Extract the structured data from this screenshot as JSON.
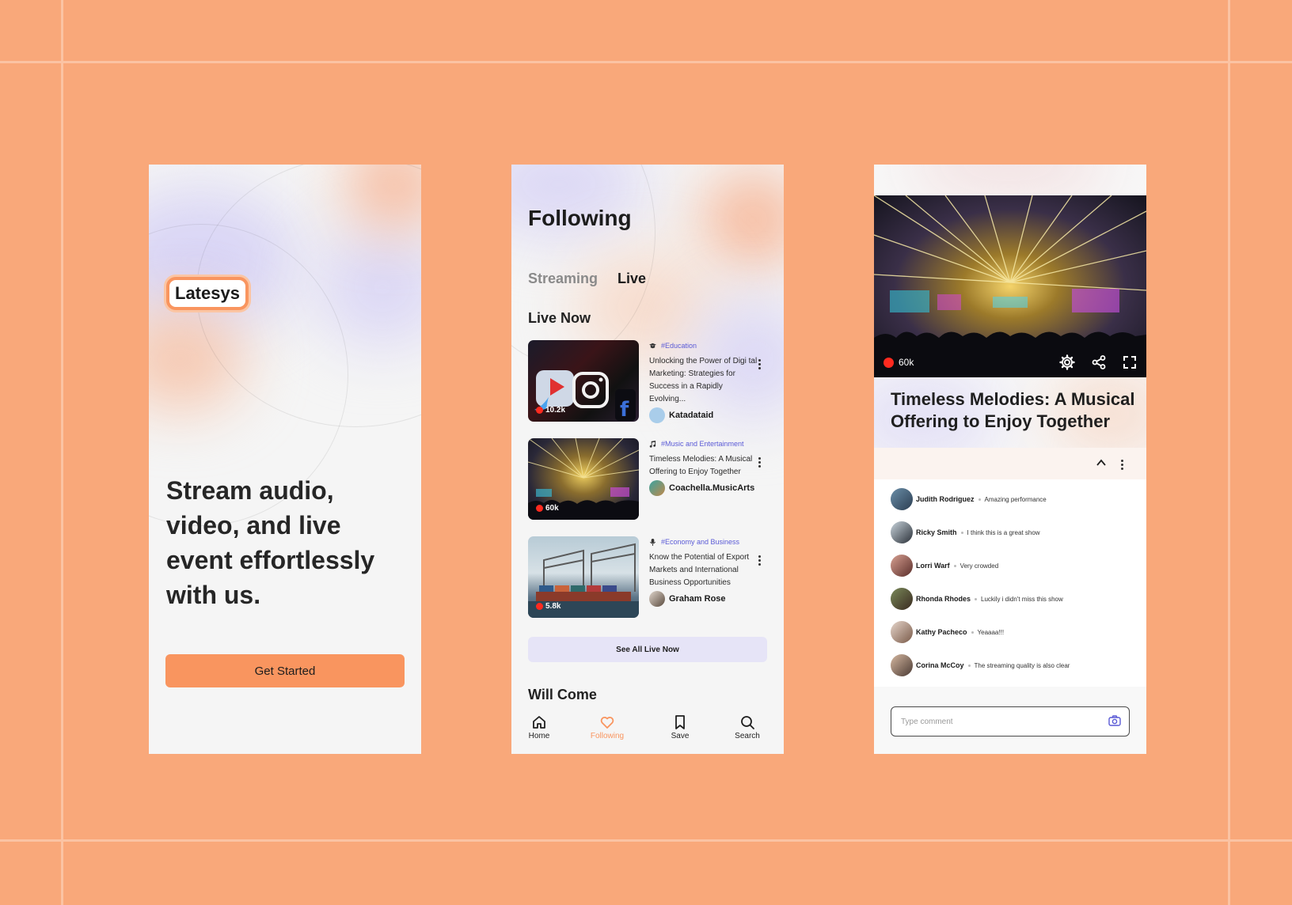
{
  "screen1": {
    "logo": "Latesys",
    "hero": "Stream audio, video, and live event effortlessly with us.",
    "cta": "Get Started"
  },
  "screen2": {
    "title": "Following",
    "tabs": [
      {
        "label": "Streaming",
        "active": false
      },
      {
        "label": "Live",
        "active": true
      }
    ],
    "live_now_title": "Live Now",
    "cards": [
      {
        "tag": "#Education",
        "title": "Unlocking the Power of Digi tal Marketing: Strategies for Success in a Rapidly Evolving...",
        "author": "Katadataid",
        "viewers": "10.2k"
      },
      {
        "tag": "#Music and Entertainment",
        "title": "Timeless Melodies: A Musical Offering to Enjoy Together",
        "author": "Coachella.MusicArts",
        "viewers": "60k"
      },
      {
        "tag": "#Economy and Business",
        "title": "Know the Potential of Export Markets and International Business Opportunities",
        "author": "Graham Rose",
        "viewers": "5.8k"
      }
    ],
    "see_all": "See All Live Now",
    "will_come_title": "Will Come",
    "nav": [
      {
        "label": "Home",
        "icon": "home-icon",
        "active": false
      },
      {
        "label": "Following",
        "icon": "heart-icon",
        "active": true
      },
      {
        "label": "Save",
        "icon": "bookmark-icon",
        "active": false
      },
      {
        "label": "Search",
        "icon": "search-icon",
        "active": false
      }
    ]
  },
  "screen3": {
    "viewers": "60k",
    "title": "Timeless Melodies: A Musical Offering to Enjoy Together",
    "comments": [
      {
        "name": "Judith Rodriguez",
        "text": "Amazing performance"
      },
      {
        "name": "Ricky Smith",
        "text": "I think this is a great show"
      },
      {
        "name": "Lorri Warf",
        "text": "Very crowded"
      },
      {
        "name": "Rhonda Rhodes",
        "text": "Luckily i didn't miss this show"
      },
      {
        "name": "Kathy Pacheco",
        "text": "Yeaaaa!!!"
      },
      {
        "name": "Corina McCoy",
        "text": "The streaming quality is also clear"
      }
    ],
    "comment_placeholder": "Type comment"
  },
  "colors": {
    "background": "#f9a87a",
    "accent": "#f9955f",
    "tag": "#5a5ad6",
    "live": "#ff2a1f",
    "see_all_bg": "#e6e4f7"
  }
}
